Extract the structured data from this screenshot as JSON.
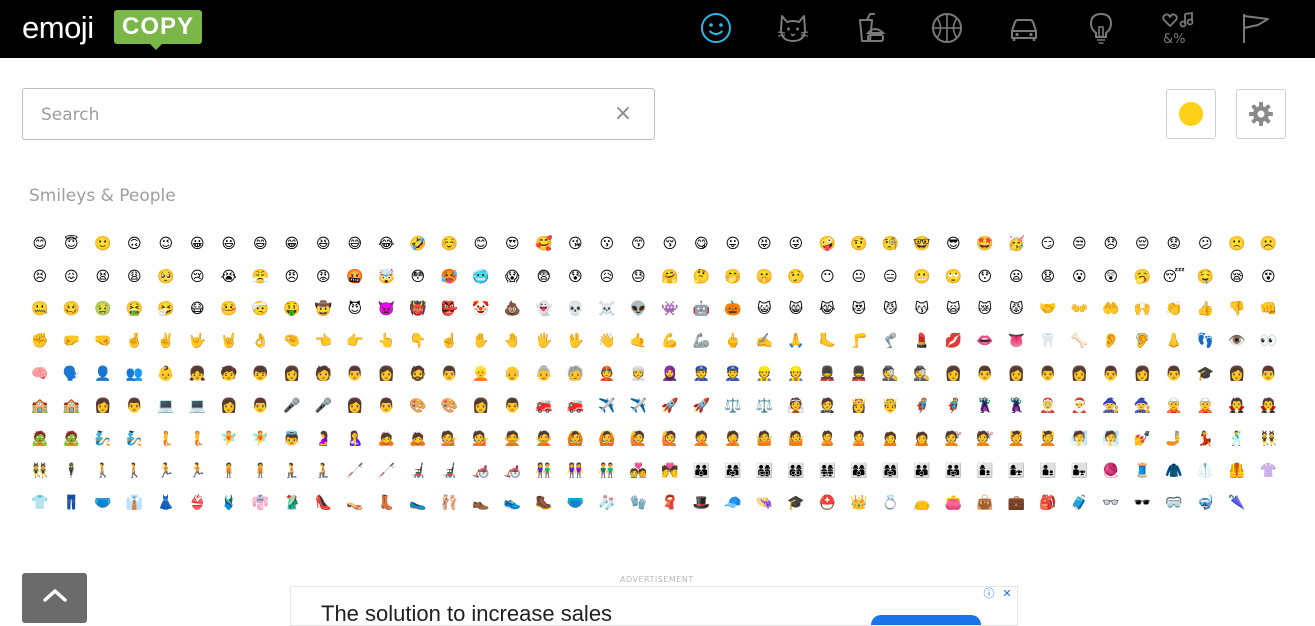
{
  "header": {
    "logo_word": "emoji",
    "logo_badge": "COPY",
    "categories": [
      {
        "name": "smileys",
        "active": true
      },
      {
        "name": "animals",
        "active": false
      },
      {
        "name": "food",
        "active": false
      },
      {
        "name": "activities",
        "active": false
      },
      {
        "name": "travel",
        "active": false
      },
      {
        "name": "objects",
        "active": false
      },
      {
        "name": "symbols",
        "active": false
      },
      {
        "name": "flags",
        "active": false
      }
    ],
    "colors": {
      "background": "#000000",
      "icon": "#7a7a7a",
      "active_icon": "#2bb7e4",
      "badge": "#7ab648"
    }
  },
  "search": {
    "placeholder": "Search",
    "value": "",
    "clear_label": "×"
  },
  "toolbar": {
    "skin_tone_color": "#fcd116",
    "settings_icon": "gear-icon"
  },
  "section": {
    "title": "Smileys & People"
  },
  "emojis": [
    "😊",
    "😇",
    "🙂",
    "🙃",
    "😉",
    "😀",
    "😃",
    "😄",
    "😁",
    "😆",
    "😅",
    "😂",
    "🤣",
    "☺️",
    "😊",
    "😍",
    "🥰",
    "😘",
    "😗",
    "😙",
    "😚",
    "😋",
    "😛",
    "😝",
    "😜",
    "🤪",
    "🤨",
    "🧐",
    "🤓",
    "😎",
    "🤩",
    "🥳",
    "😏",
    "😒",
    "😞",
    "😔",
    "😟",
    "😕",
    "🙁",
    "☹️",
    "😣",
    "😖",
    "😫",
    "😩",
    "🥺",
    "😢",
    "😭",
    "😤",
    "😠",
    "😡",
    "🤬",
    "🤯",
    "😳",
    "🥵",
    "🥶",
    "😱",
    "😨",
    "😰",
    "😥",
    "😓",
    "🤗",
    "🤔",
    "🤭",
    "🤫",
    "🤥",
    "😶",
    "😐",
    "😑",
    "😬",
    "🙄",
    "😯",
    "😦",
    "😧",
    "😮",
    "😲",
    "🥱",
    "😴",
    "🤤",
    "😪",
    "😵",
    "🤐",
    "🥴",
    "🤢",
    "🤮",
    "🤧",
    "😷",
    "🤒",
    "🤕",
    "🤑",
    "🤠",
    "😈",
    "👿",
    "👹",
    "👺",
    "🤡",
    "💩",
    "👻",
    "💀",
    "☠️",
    "👽",
    "👾",
    "🤖",
    "🎃",
    "😺",
    "😸",
    "😹",
    "😻",
    "😼",
    "😽",
    "🙀",
    "😿",
    "😾",
    "🤝",
    "👐",
    "🤲",
    "🙌",
    "👏",
    "👍",
    "👎",
    "👊",
    "✊",
    "🤛",
    "🤜",
    "🤞",
    "✌️",
    "🤟",
    "🤘",
    "👌",
    "🤏",
    "👈",
    "👉",
    "👆",
    "👇",
    "☝️",
    "✋",
    "🤚",
    "🖐️",
    "🖖",
    "👋",
    "🤙",
    "💪",
    "🦾",
    "🖕",
    "✍️",
    "🙏",
    "🦶",
    "🦵",
    "🦿",
    "💄",
    "💋",
    "👄",
    "👅",
    "🦷",
    "🦴",
    "👂",
    "🦻",
    "👃",
    "👣",
    "👁️",
    "👀",
    "🧠",
    "🗣️",
    "👤",
    "👥",
    "👶",
    "👧",
    "🧒",
    "👦",
    "👩",
    "🧑",
    "👨",
    "👩",
    "🧔",
    "👨",
    "👱",
    "👴",
    "👵",
    "🧓",
    "👲",
    "👳",
    "🧕",
    "👮",
    "👮",
    "👷",
    "👷",
    "💂",
    "💂",
    "🕵️",
    "🕵️",
    "👩",
    "👨",
    "👩",
    "👨",
    "👩",
    "👨",
    "👩",
    "👨",
    "🎓",
    "👩",
    "👨",
    "🏫",
    "🏫",
    "👩",
    "👨",
    "💻",
    "💻",
    "👩",
    "👨",
    "🎤",
    "🎤",
    "👩",
    "👨",
    "🎨",
    "🎨",
    "👩",
    "👨",
    "🚒",
    "🚒",
    "✈️",
    "✈️",
    "🚀",
    "🚀",
    "⚖️",
    "⚖️",
    "👰",
    "🤵",
    "👸",
    "🤴",
    "🦸",
    "🦸",
    "🦹",
    "🦹",
    "🤶",
    "🎅",
    "🧙",
    "🧙",
    "🧝",
    "🧝",
    "🧛",
    "🧛",
    "🧟",
    "🧟",
    "🧞",
    "🧞",
    "🧜",
    "🧜",
    "🧚",
    "🧚",
    "👼",
    "🤰",
    "🤱",
    "🙇",
    "🙇",
    "💁",
    "💁",
    "🙅",
    "🙅",
    "🙆",
    "🙆",
    "🙋",
    "🙋",
    "🤦",
    "🤦",
    "🤷",
    "🤷",
    "🙎",
    "🙎",
    "🙍",
    "🙍",
    "💇",
    "💇",
    "💆",
    "💆",
    "🧖",
    "🧖",
    "💅",
    "🤳",
    "💃",
    "🕺",
    "👯",
    "👯",
    "🕴️",
    "🚶",
    "🚶",
    "🏃",
    "🏃",
    "🧍",
    "🧍",
    "🧎",
    "🧎",
    "🦯",
    "🦯",
    "🦼",
    "🦼",
    "🦽",
    "🦽",
    "👫",
    "👭",
    "👬",
    "💑",
    "💏",
    "👪",
    "👨‍👩‍👧",
    "👨‍👩‍👧‍👦",
    "👨‍👩‍👦‍👦",
    "👨‍👩‍👧‍👧",
    "👩‍👩‍👦",
    "👩‍👩‍👧",
    "👨‍👨‍👦",
    "👨‍👨‍👧",
    "👩‍👦",
    "👩‍👧",
    "👨‍👦",
    "👨‍👧",
    "🧶",
    "🧵",
    "🧥",
    "🥼",
    "🦺",
    "👚",
    "👕",
    "👖",
    "🩲",
    "👔",
    "👗",
    "👙",
    "🩱",
    "👘",
    "🥻",
    "👠",
    "👡",
    "👢",
    "🥿",
    "🩰",
    "👞",
    "👟",
    "🥾",
    "🩲",
    "🧦",
    "🧤",
    "🧣",
    "🎩",
    "🧢",
    "👒",
    "🎓",
    "⛑️",
    "👑",
    "💍",
    "👝",
    "👛",
    "👜",
    "💼",
    "🎒",
    "🧳",
    "👓",
    "🕶️",
    "🥽",
    "🤿",
    "🌂"
  ],
  "scroll_up": {
    "icon": "chevron-up-icon"
  },
  "advertisement": {
    "label": "ADVERTISEMENT",
    "headline": "The solution to increase sales",
    "info_icon": "ⓘ",
    "close_icon": "✕"
  }
}
